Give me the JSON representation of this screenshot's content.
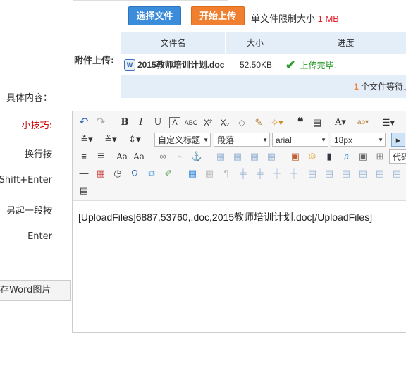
{
  "upload": {
    "select_label": "选择文件",
    "start_label": "开始上传",
    "limit_text": "单文件限制大小",
    "limit_value": "1 MB",
    "section_label": "附件上传:",
    "columns": [
      "文件名",
      "大小",
      "进度"
    ],
    "file": {
      "name": "2015教师培训计划.doc",
      "size": "52.50KB",
      "status": "上传完毕."
    },
    "queue_count": "1",
    "queue_text": "个文件等待上"
  },
  "form": {
    "content_label": "具体内容：",
    "tip_title": "小技巧:",
    "tip_line1": "换行按",
    "tip_line2": "Shift+Enter",
    "tip_line3": "另起一段按",
    "tip_line4": "Enter",
    "word_button": "存Word图片"
  },
  "toolbar": {
    "heading_select": "自定义标题",
    "paragraph_select": "段落",
    "font_select": "arial",
    "size_select": "18px",
    "code_label": "代码"
  },
  "editor": {
    "content": "[UploadFiles]6887,53760,.doc,2015教师培训计划.doc[/UploadFiles]"
  },
  "colors": {
    "blue": "#3b8ddc",
    "orange": "#f08030",
    "red": "#e8202a",
    "green": "#2a9c2a",
    "header_bg": "#e4eef9"
  }
}
